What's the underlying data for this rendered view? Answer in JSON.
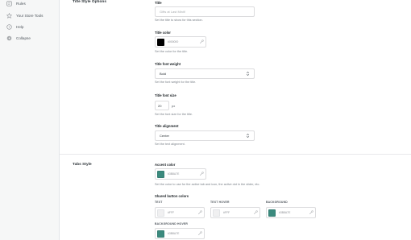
{
  "sidebar": {
    "items": [
      {
        "label": "Rules",
        "icon": "rules-icon"
      },
      {
        "label": "Your Store Tools",
        "icon": "star-icon"
      },
      {
        "label": "Help",
        "icon": "help-icon"
      },
      {
        "label": "Collapse",
        "icon": "collapse-icon"
      }
    ]
  },
  "title_style": {
    "heading": "Title Style Options",
    "title": {
      "label": "Title",
      "placeholder": "Gifts at Last Minit!",
      "help": "Set the title to show for this section."
    },
    "title_color": {
      "label": "Title color",
      "hex": "#000000",
      "swatch": "#000000",
      "help": "Set the color for the title."
    },
    "font_weight": {
      "label": "Title font weight",
      "value": "Bold",
      "help": "Set the font weight for the title."
    },
    "font_size": {
      "label": "Title font size",
      "value": "20",
      "unit": "px",
      "help": "Set the font size for the title."
    },
    "alignment": {
      "label": "Title alignment",
      "value": "Center",
      "help": "Set the text alignment."
    }
  },
  "tabs_style": {
    "heading": "Tabs Style",
    "accent": {
      "label": "Accent color",
      "hex": "#3B8A7E",
      "swatch": "#3b8a7e",
      "help": "Set the color to use for the active tab and icon, the active dot in the slider, etc."
    },
    "shared": {
      "label": "Shared button colors",
      "text": {
        "label": "TEXT",
        "hex": "#FFF"
      },
      "text_hover": {
        "label": "TEXT HOVER",
        "hex": "#FFF"
      },
      "background": {
        "label": "BACKGROUND",
        "hex": "#3B8A7E",
        "swatch": "#3b8a7e"
      },
      "background_hover": {
        "label": "BACKGROUND HOVER",
        "hex": "#3B8A7E",
        "swatch": "#3b8a7e"
      }
    }
  }
}
